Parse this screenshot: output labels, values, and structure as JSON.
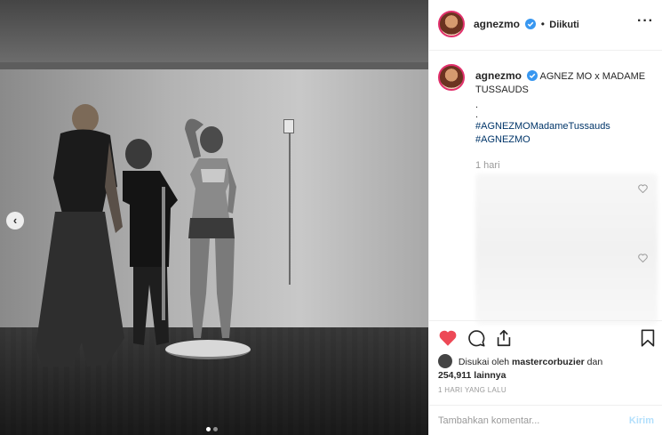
{
  "header": {
    "username": "agnezmo",
    "separator": "•",
    "follow_status": "Diikuti",
    "more": "···"
  },
  "caption": {
    "username": "agnezmo",
    "text_line1": "AGNEZ MO x MADAME",
    "text_line2": "TUSSAUDS",
    "dot1": ".",
    "dot2": ".",
    "hashtag1": "#AGNEZMOMadameTussauds",
    "hashtag2": "#AGNEZMO",
    "time": "1 hari"
  },
  "actions": {
    "like_icon": "heart-filled-icon",
    "comment_icon": "comment-icon",
    "share_icon": "share-icon",
    "save_icon": "bookmark-icon"
  },
  "likes": {
    "prefix": "Disukai oleh",
    "liker": "mastercorbuzier",
    "joiner": "dan",
    "count": "254,911 lainnya"
  },
  "posted_ago": "1 HARI YANG LALU",
  "comment": {
    "placeholder": "Tambahkan komentar...",
    "send_label": "Kirim"
  },
  "colors": {
    "like_red": "#ed4956",
    "verified_blue": "#3897f0",
    "hashtag_blue": "#003569",
    "send_disabled": "#b2dffc"
  }
}
